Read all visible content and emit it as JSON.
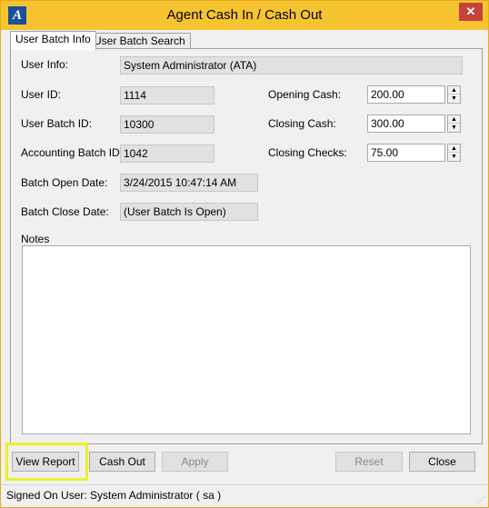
{
  "window": {
    "title": "Agent Cash In / Cash Out",
    "close_glyph": "✕",
    "app_icon_glyph": "A"
  },
  "tabs": [
    {
      "label": "User Batch Info",
      "active": true
    },
    {
      "label": "User Batch Search",
      "active": false
    }
  ],
  "fields": {
    "user_info": {
      "label": "User Info:",
      "value": "System Administrator (ATA)"
    },
    "user_id": {
      "label": "User ID:",
      "value": "1114"
    },
    "user_batch_id": {
      "label": "User Batch ID:",
      "value": "10300"
    },
    "accounting_batch_id": {
      "label": "Accounting Batch ID:",
      "value": "1042"
    },
    "batch_open_date": {
      "label": "Batch Open Date:",
      "value": "3/24/2015 10:47:14 AM"
    },
    "batch_close_date": {
      "label": "Batch Close Date:",
      "value": "(User Batch Is Open)"
    },
    "opening_cash": {
      "label": "Opening Cash:",
      "value": "200.00"
    },
    "closing_cash": {
      "label": "Closing Cash:",
      "value": "300.00"
    },
    "closing_checks": {
      "label": "Closing Checks:",
      "value": "75.00"
    },
    "notes": {
      "label": "Notes",
      "value": ""
    }
  },
  "buttons": {
    "view_report": "View Report",
    "cash_out": "Cash Out",
    "apply": "Apply",
    "reset": "Reset",
    "close": "Close"
  },
  "status": {
    "text": "Signed On User: System Administrator ( sa )"
  },
  "colors": {
    "titlebar": "#f7c431",
    "close_button": "#c7423a",
    "highlight": "#ecf02a"
  },
  "icons": {
    "spin_up": "▲",
    "spin_down": "▼",
    "grip": "⋰"
  }
}
